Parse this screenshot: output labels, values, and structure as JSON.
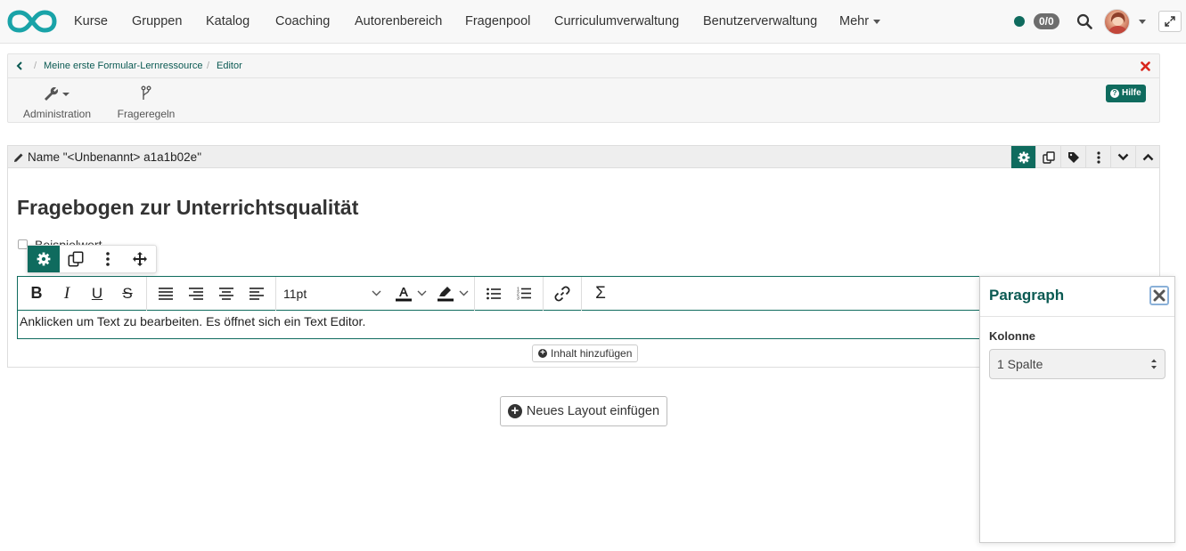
{
  "nav": {
    "items": [
      "Kurse",
      "Gruppen",
      "Katalog",
      "Coaching",
      "Autorenbereich",
      "Fragenpool",
      "Curriculumverwaltung",
      "Benutzerverwaltung",
      "Mehr"
    ],
    "badge": "0/0",
    "status_color": "#0f6b5e"
  },
  "breadcrumb": {
    "items": [
      "Meine erste Formular-Lernressource",
      "Editor"
    ],
    "separator": "/"
  },
  "toolbar": {
    "administration": "Administration",
    "frageregeln": "Frageregeln",
    "help": "Hilfe"
  },
  "section": {
    "name": "Name \"<Unbenannt> a1a1b02e\"",
    "form_title": "Fragebogen zur Unterrichtsqualität",
    "checkbox_label": "Beispielwert"
  },
  "editor": {
    "font_size": "11pt",
    "body": "Anklicken um Text zu bearbeiten. Es öffnet sich ein Text Editor."
  },
  "actions": {
    "add_content": "Inhalt hinzufügen",
    "new_layout": "Neues Layout einfügen"
  },
  "inspector": {
    "title": "Paragraph",
    "column_label": "Kolonne",
    "column_value": "1 Spalte"
  },
  "colors": {
    "accent": "#0f6b5e",
    "danger": "#d9261c"
  }
}
